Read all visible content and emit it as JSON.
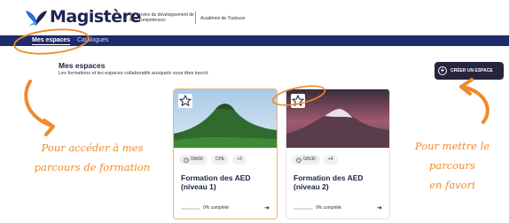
{
  "header": {
    "logo_text": "Magistère",
    "tagline": "Au service du développement de mes compétences",
    "academy": "Académie de Toulouse"
  },
  "nav": {
    "active": "Mes espaces",
    "other": "Catalogues"
  },
  "section": {
    "title": "Mes espaces",
    "subtitle": "Les formations et les espaces collaboratifs auxquels vous êtes inscrit.",
    "create_button": "CRÉER UN ESPACE"
  },
  "cards": [
    {
      "badges": [
        "03h00",
        "CPE",
        "+3"
      ],
      "title": "Formation des AED (niveau 1)",
      "progress_label": "0% complété",
      "progress": 0
    },
    {
      "badges": [
        "02h30",
        "+4"
      ],
      "title": "Formation des AED (niveau 2)",
      "progress_label": "0% complété",
      "progress": 0
    }
  ],
  "annotations": {
    "left_line1": "Pour accéder à mes",
    "left_line2": "parcours de formation",
    "right_line1": "Pour mettre le",
    "right_line2": "parcours",
    "right_line3": "en favori"
  },
  "colors": {
    "nav": "#1e2a6b",
    "button": "#27243e",
    "annotation": "#f08a2a"
  },
  "icons": [
    "butterfly-logo-icon",
    "plus-circle-icon",
    "star-outline-icon",
    "clock-icon",
    "arrow-right-icon"
  ]
}
